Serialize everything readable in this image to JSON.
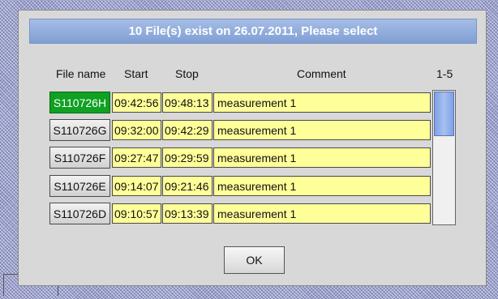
{
  "dialog": {
    "title": "10 File(s) exist on 26.07.2011, Please select",
    "ok_label": "OK"
  },
  "table": {
    "headers": {
      "file_name": "File name",
      "start": "Start",
      "stop": "Stop",
      "comment": "Comment",
      "range": "1-5"
    },
    "rows": [
      {
        "file": "S110726H",
        "start": "09:42:56",
        "stop": "09:48:13",
        "comment": "measurement 1",
        "selected": true
      },
      {
        "file": "S110726G",
        "start": "09:32:00",
        "stop": "09:42:29",
        "comment": "measurement 1",
        "selected": false
      },
      {
        "file": "S110726F",
        "start": "09:27:47",
        "stop": "09:29:59",
        "comment": "measurement 1",
        "selected": false
      },
      {
        "file": "S110726E",
        "start": "09:14:07",
        "stop": "09:21:46",
        "comment": "measurement 1",
        "selected": false
      },
      {
        "file": "S110726D",
        "start": "09:10:57",
        "stop": "09:13:39",
        "comment": "measurement 1",
        "selected": false
      }
    ]
  },
  "colors": {
    "selected_button": "#10a022",
    "cell_background": "#ffff99",
    "title_bar": "#8fabdc"
  }
}
